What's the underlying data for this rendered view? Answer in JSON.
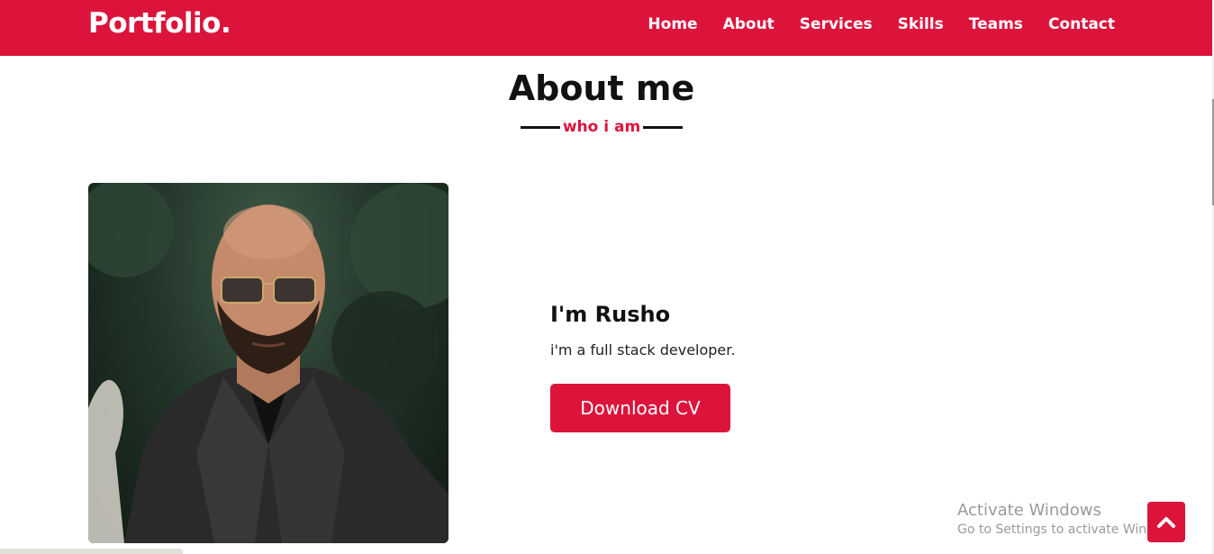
{
  "nav": {
    "logo": "Portfolio.",
    "items": [
      {
        "label": "Home"
      },
      {
        "label": "About"
      },
      {
        "label": "Services"
      },
      {
        "label": "Skills"
      },
      {
        "label": "Teams"
      },
      {
        "label": "Contact"
      }
    ]
  },
  "about": {
    "title": "About me",
    "subtitle": "who i am",
    "name": "I'm Rusho",
    "description": "i'm a full stack developer.",
    "button_label": "Download CV",
    "photo_icon": "profile-photo"
  },
  "watermark": {
    "title": "Activate Windows",
    "subtitle": "Go to Settings to activate Windows."
  },
  "scroll_top": {
    "icon": "chevron-up-icon"
  },
  "colors": {
    "accent": "#dc143c",
    "text": "#111111",
    "background": "#ffffff"
  }
}
